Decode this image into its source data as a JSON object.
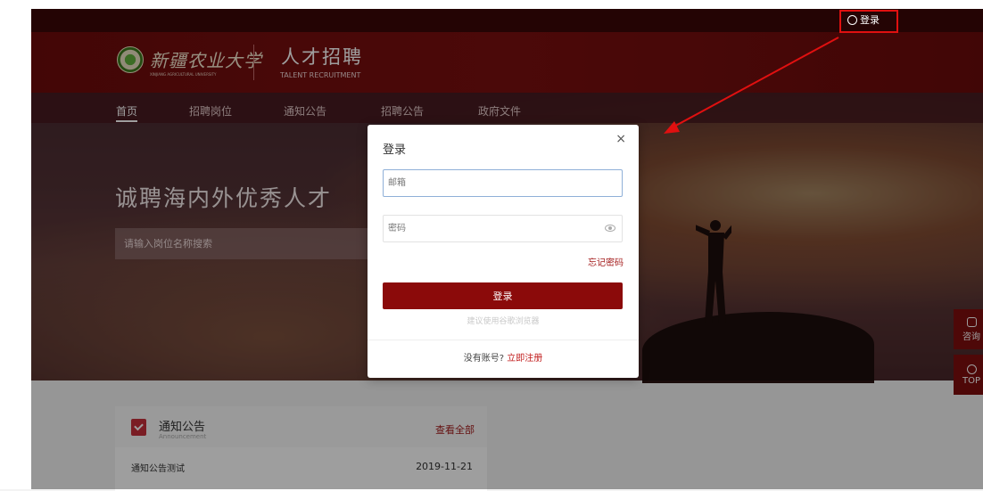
{
  "topbar": {
    "login_label": "登录"
  },
  "header": {
    "logo_script": "新疆农业大学",
    "logo_sub": "XINJIANG AGRICULTURAL UNIVERSITY",
    "brand_cn": "人才招聘",
    "brand_en": "TALENT RECRUITMENT"
  },
  "nav": {
    "items": [
      {
        "label": "首页"
      },
      {
        "label": "招聘岗位"
      },
      {
        "label": "通知公告"
      },
      {
        "label": "招聘公告"
      },
      {
        "label": "政府文件"
      }
    ]
  },
  "hero": {
    "title": "诚聘海内外优秀人才",
    "search_placeholder": "请输入岗位名称搜索"
  },
  "side": {
    "consult": "咨询",
    "top": "TOP"
  },
  "notice": {
    "title": "通知公告",
    "subtitle": "Announcement",
    "view_all": "查看全部",
    "rows": [
      {
        "title": "通知公告测试",
        "date": "2019-11-21"
      }
    ]
  },
  "modal": {
    "title": "登录",
    "close_glyph": "×",
    "email_placeholder": "邮箱",
    "password_placeholder": "密码",
    "forgot": "忘记密码",
    "login_button": "登录",
    "hint": "建议使用谷歌浏览器",
    "no_account": "没有账号?",
    "register": "立即注册"
  },
  "colors": {
    "brand": "#8b0a0a",
    "accent_link": "#a41c1c",
    "annotation": "#e01010"
  }
}
